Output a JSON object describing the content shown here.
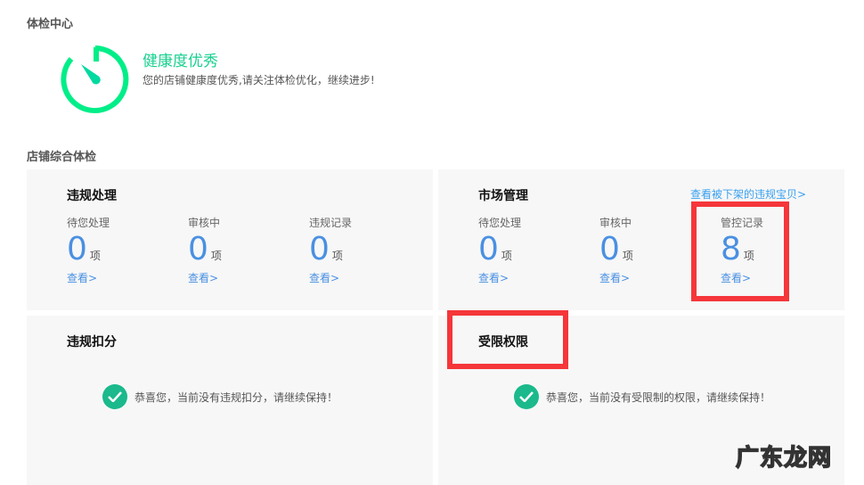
{
  "header": {
    "title": "体检中心"
  },
  "health": {
    "status": "健康度优秀",
    "desc": "您的店铺健康度优秀,请关注体检优化，继续进步!",
    "color": "#00e67a"
  },
  "overview": {
    "title": "店铺综合体检"
  },
  "violation": {
    "title": "违规处理",
    "cols": [
      {
        "label": "待您处理",
        "value": "0",
        "unit": "项",
        "link": "查看>"
      },
      {
        "label": "审核中",
        "value": "0",
        "unit": "项",
        "link": "查看>"
      },
      {
        "label": "违规记录",
        "value": "0",
        "unit": "项",
        "link": "查看>"
      }
    ]
  },
  "market": {
    "title": "市场管理",
    "top_link": "查看被下架的违规宝贝>",
    "cols": [
      {
        "label": "待您处理",
        "value": "0",
        "unit": "项",
        "link": "查看>"
      },
      {
        "label": "审核中",
        "value": "0",
        "unit": "项",
        "link": "查看>"
      },
      {
        "label": "管控记录",
        "value": "8",
        "unit": "项",
        "link": "查看>"
      }
    ]
  },
  "deduction": {
    "title": "违规扣分",
    "message": "恭喜您，当前没有违规扣分，请继续保持！"
  },
  "restricted": {
    "title": "受限权限",
    "message": "恭喜您，当前没有受限制的权限，请继续保持！"
  },
  "watermark": "广东龙网"
}
